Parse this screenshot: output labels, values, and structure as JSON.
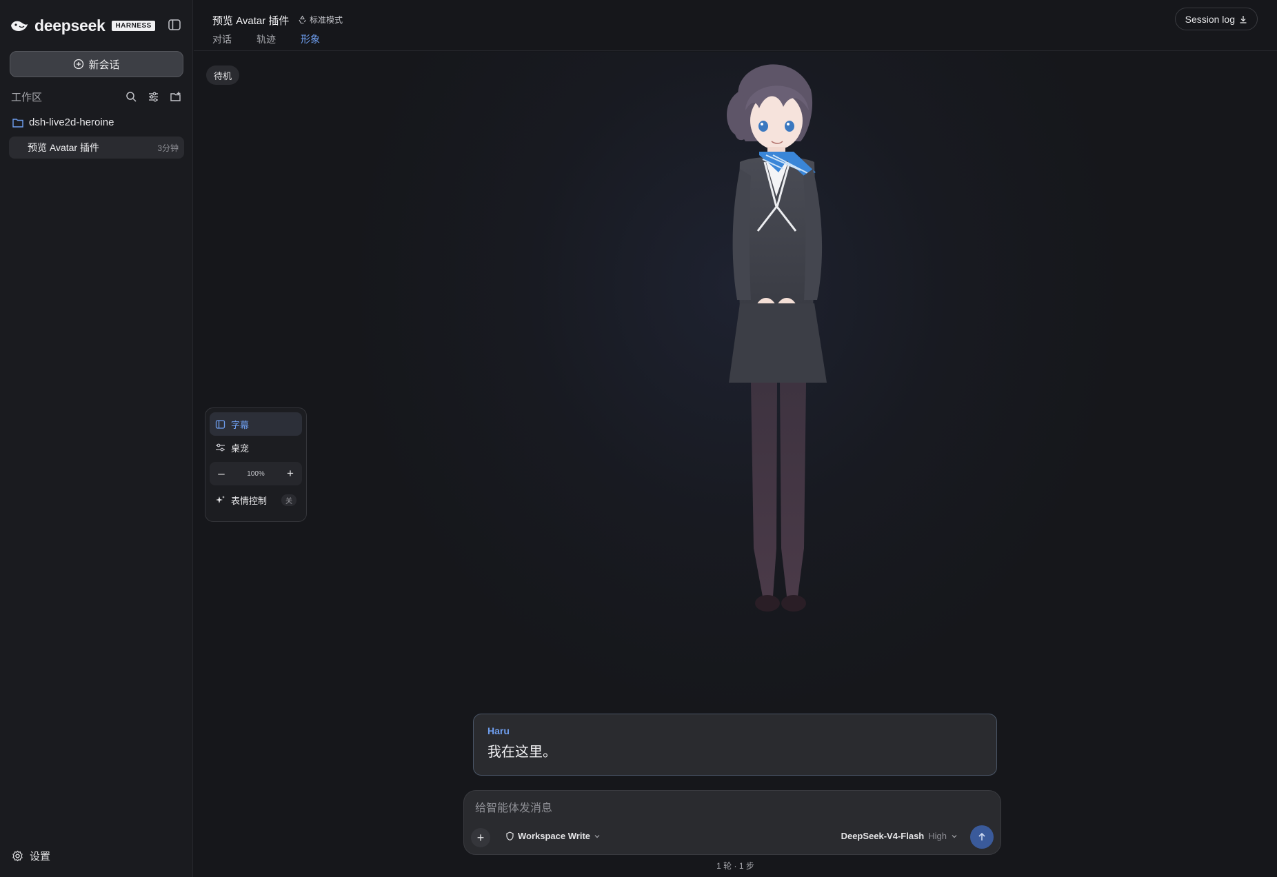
{
  "brand": {
    "name": "deepseek",
    "tag": "HARNESS"
  },
  "sidebar": {
    "new_chat": "新会话",
    "workspace_label": "工作区",
    "folder": "dsh-live2d-heroine",
    "session": {
      "title": "预览 Avatar 插件",
      "time": "3分钟"
    },
    "settings": "设置"
  },
  "header": {
    "title": "预览 Avatar 插件",
    "mode": "标准模式",
    "tabs": [
      "对话",
      "轨迹",
      "形象"
    ],
    "active_tab": "形象",
    "session_log": "Session log"
  },
  "stage": {
    "status_pill": "待机",
    "controls": {
      "subtitle": "字幕",
      "desktop": "桌宠",
      "zoom": "100%",
      "expression": "表情控制",
      "expression_state": "关"
    },
    "bubble": {
      "speaker": "Haru",
      "text": "我在这里。"
    }
  },
  "composer": {
    "placeholder": "给智能体发消息",
    "permission": "Workspace Write",
    "model": "DeepSeek-V4-Flash",
    "effort": "High"
  },
  "footer": "1 轮 · 1 步",
  "colors": {
    "accent": "#6f9ff0",
    "bg": "#16171b",
    "sidebar": "#1a1b1f",
    "send": "#3a5a9a"
  }
}
